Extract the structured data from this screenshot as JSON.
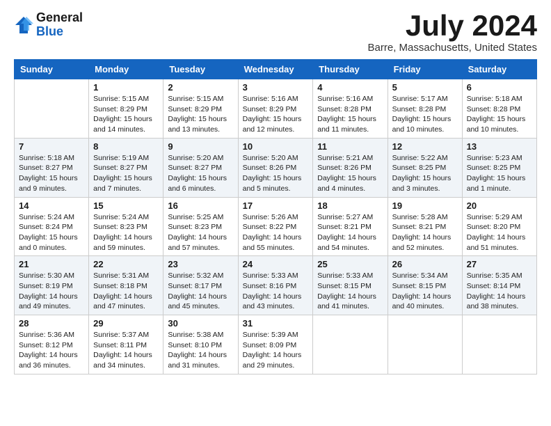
{
  "logo": {
    "general": "General",
    "blue": "Blue"
  },
  "title": "July 2024",
  "location": "Barre, Massachusetts, United States",
  "days_of_week": [
    "Sunday",
    "Monday",
    "Tuesday",
    "Wednesday",
    "Thursday",
    "Friday",
    "Saturday"
  ],
  "weeks": [
    [
      {
        "day": "",
        "info": ""
      },
      {
        "day": "1",
        "info": "Sunrise: 5:15 AM\nSunset: 8:29 PM\nDaylight: 15 hours\nand 14 minutes."
      },
      {
        "day": "2",
        "info": "Sunrise: 5:15 AM\nSunset: 8:29 PM\nDaylight: 15 hours\nand 13 minutes."
      },
      {
        "day": "3",
        "info": "Sunrise: 5:16 AM\nSunset: 8:29 PM\nDaylight: 15 hours\nand 12 minutes."
      },
      {
        "day": "4",
        "info": "Sunrise: 5:16 AM\nSunset: 8:28 PM\nDaylight: 15 hours\nand 11 minutes."
      },
      {
        "day": "5",
        "info": "Sunrise: 5:17 AM\nSunset: 8:28 PM\nDaylight: 15 hours\nand 10 minutes."
      },
      {
        "day": "6",
        "info": "Sunrise: 5:18 AM\nSunset: 8:28 PM\nDaylight: 15 hours\nand 10 minutes."
      }
    ],
    [
      {
        "day": "7",
        "info": "Sunrise: 5:18 AM\nSunset: 8:27 PM\nDaylight: 15 hours\nand 9 minutes."
      },
      {
        "day": "8",
        "info": "Sunrise: 5:19 AM\nSunset: 8:27 PM\nDaylight: 15 hours\nand 7 minutes."
      },
      {
        "day": "9",
        "info": "Sunrise: 5:20 AM\nSunset: 8:27 PM\nDaylight: 15 hours\nand 6 minutes."
      },
      {
        "day": "10",
        "info": "Sunrise: 5:20 AM\nSunset: 8:26 PM\nDaylight: 15 hours\nand 5 minutes."
      },
      {
        "day": "11",
        "info": "Sunrise: 5:21 AM\nSunset: 8:26 PM\nDaylight: 15 hours\nand 4 minutes."
      },
      {
        "day": "12",
        "info": "Sunrise: 5:22 AM\nSunset: 8:25 PM\nDaylight: 15 hours\nand 3 minutes."
      },
      {
        "day": "13",
        "info": "Sunrise: 5:23 AM\nSunset: 8:25 PM\nDaylight: 15 hours\nand 1 minute."
      }
    ],
    [
      {
        "day": "14",
        "info": "Sunrise: 5:24 AM\nSunset: 8:24 PM\nDaylight: 15 hours\nand 0 minutes."
      },
      {
        "day": "15",
        "info": "Sunrise: 5:24 AM\nSunset: 8:23 PM\nDaylight: 14 hours\nand 59 minutes."
      },
      {
        "day": "16",
        "info": "Sunrise: 5:25 AM\nSunset: 8:23 PM\nDaylight: 14 hours\nand 57 minutes."
      },
      {
        "day": "17",
        "info": "Sunrise: 5:26 AM\nSunset: 8:22 PM\nDaylight: 14 hours\nand 55 minutes."
      },
      {
        "day": "18",
        "info": "Sunrise: 5:27 AM\nSunset: 8:21 PM\nDaylight: 14 hours\nand 54 minutes."
      },
      {
        "day": "19",
        "info": "Sunrise: 5:28 AM\nSunset: 8:21 PM\nDaylight: 14 hours\nand 52 minutes."
      },
      {
        "day": "20",
        "info": "Sunrise: 5:29 AM\nSunset: 8:20 PM\nDaylight: 14 hours\nand 51 minutes."
      }
    ],
    [
      {
        "day": "21",
        "info": "Sunrise: 5:30 AM\nSunset: 8:19 PM\nDaylight: 14 hours\nand 49 minutes."
      },
      {
        "day": "22",
        "info": "Sunrise: 5:31 AM\nSunset: 8:18 PM\nDaylight: 14 hours\nand 47 minutes."
      },
      {
        "day": "23",
        "info": "Sunrise: 5:32 AM\nSunset: 8:17 PM\nDaylight: 14 hours\nand 45 minutes."
      },
      {
        "day": "24",
        "info": "Sunrise: 5:33 AM\nSunset: 8:16 PM\nDaylight: 14 hours\nand 43 minutes."
      },
      {
        "day": "25",
        "info": "Sunrise: 5:33 AM\nSunset: 8:15 PM\nDaylight: 14 hours\nand 41 minutes."
      },
      {
        "day": "26",
        "info": "Sunrise: 5:34 AM\nSunset: 8:15 PM\nDaylight: 14 hours\nand 40 minutes."
      },
      {
        "day": "27",
        "info": "Sunrise: 5:35 AM\nSunset: 8:14 PM\nDaylight: 14 hours\nand 38 minutes."
      }
    ],
    [
      {
        "day": "28",
        "info": "Sunrise: 5:36 AM\nSunset: 8:12 PM\nDaylight: 14 hours\nand 36 minutes."
      },
      {
        "day": "29",
        "info": "Sunrise: 5:37 AM\nSunset: 8:11 PM\nDaylight: 14 hours\nand 34 minutes."
      },
      {
        "day": "30",
        "info": "Sunrise: 5:38 AM\nSunset: 8:10 PM\nDaylight: 14 hours\nand 31 minutes."
      },
      {
        "day": "31",
        "info": "Sunrise: 5:39 AM\nSunset: 8:09 PM\nDaylight: 14 hours\nand 29 minutes."
      },
      {
        "day": "",
        "info": ""
      },
      {
        "day": "",
        "info": ""
      },
      {
        "day": "",
        "info": ""
      }
    ]
  ]
}
